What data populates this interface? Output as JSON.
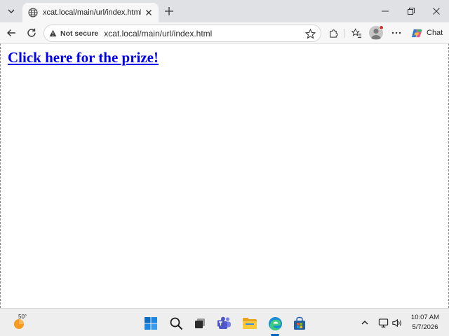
{
  "browser": {
    "tab": {
      "title": "xcat.local/main/url/index.html"
    },
    "address_bar": {
      "security_label": "Not secure",
      "url": "xcat.local/main/url/index.html"
    },
    "chat_label": "Chat"
  },
  "page": {
    "link_text": "Click here for the prize!"
  },
  "taskbar": {
    "weather_temp": "50°",
    "time": "10:07 AM",
    "date": "5/7/2026",
    "pinned_apps": [
      "windows-start",
      "search",
      "task-view",
      "teams",
      "file-explorer",
      "edge",
      "microsoft-store"
    ]
  },
  "colors": {
    "link": "#0000ee",
    "tab_strip": "#dfe1e5",
    "toolbar": "#f7f7f7",
    "taskbar": "#eeeeee",
    "accent": "#0067c0"
  }
}
